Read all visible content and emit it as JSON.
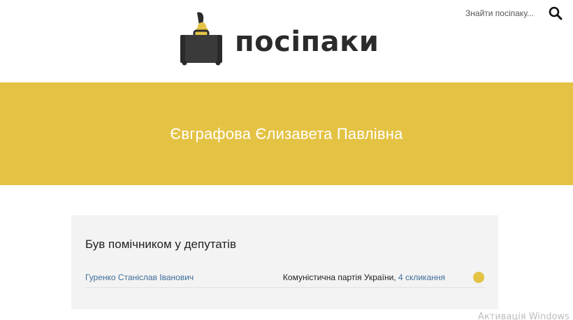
{
  "header": {
    "logo_text": "посіпаки",
    "search": {
      "placeholder": "Знайти посіпаку...",
      "icon": "search-icon"
    }
  },
  "banner": {
    "person_name": "Євграфова Єлизавета Павлівна",
    "background_color": "#e4c244"
  },
  "assistant_section": {
    "title": "Був помічником у депутатів",
    "rows": [
      {
        "deputy_name": "Гуренко Станіслав Іванович",
        "party": "Комуністична партія України",
        "separator": ", ",
        "convocation": "4 скликання",
        "status_color": "#e4c244"
      }
    ]
  },
  "watermark": "Активація Windows"
}
